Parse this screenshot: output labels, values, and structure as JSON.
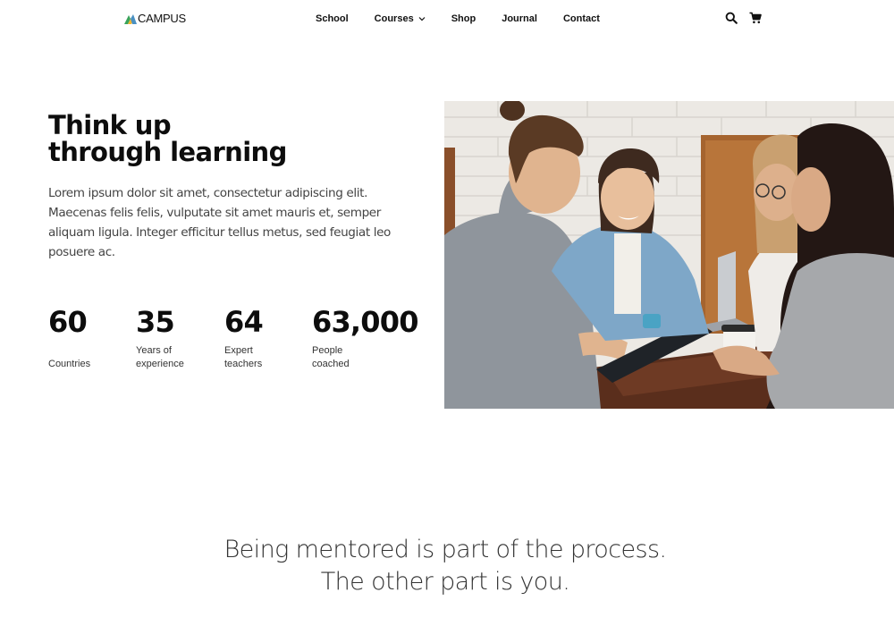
{
  "header": {
    "logo_text": "CAMPUS",
    "logo_colors": [
      "#3aa35b",
      "#f2b632",
      "#4a90c2"
    ],
    "nav": [
      {
        "label": "School"
      },
      {
        "label": "Courses",
        "has_dropdown": true,
        "dropdown_icon": "chevron-down-icon"
      },
      {
        "label": "Shop"
      },
      {
        "label": "Journal"
      },
      {
        "label": "Contact"
      }
    ],
    "tools": [
      {
        "icon": "search-icon"
      },
      {
        "icon": "cart-icon"
      }
    ]
  },
  "hero": {
    "title_line1": "Think up",
    "title_line2": "through learning",
    "text": "Lorem ipsum dolor sit amet, consectetur adipiscing elit. Maecenas felis felis, vulputate sit amet mauris et, semper aliquam ligula. Integer efficitur tellus metus, sed feugiat leo posuere ac.",
    "stats": [
      {
        "value": "60",
        "label_line1": "Countries",
        "label_line2": ""
      },
      {
        "value": "35",
        "label_line1": "Years of",
        "label_line2": "experience"
      },
      {
        "value": "64",
        "label_line1": "Expert",
        "label_line2": "teachers"
      },
      {
        "value": "63,000",
        "label_line1": "People",
        "label_line2": "coached"
      }
    ],
    "photo": {
      "subject": "students-studying-photo"
    }
  },
  "quote": {
    "line1": "Being mentored is part of the process.",
    "line2": "The other part is you."
  }
}
